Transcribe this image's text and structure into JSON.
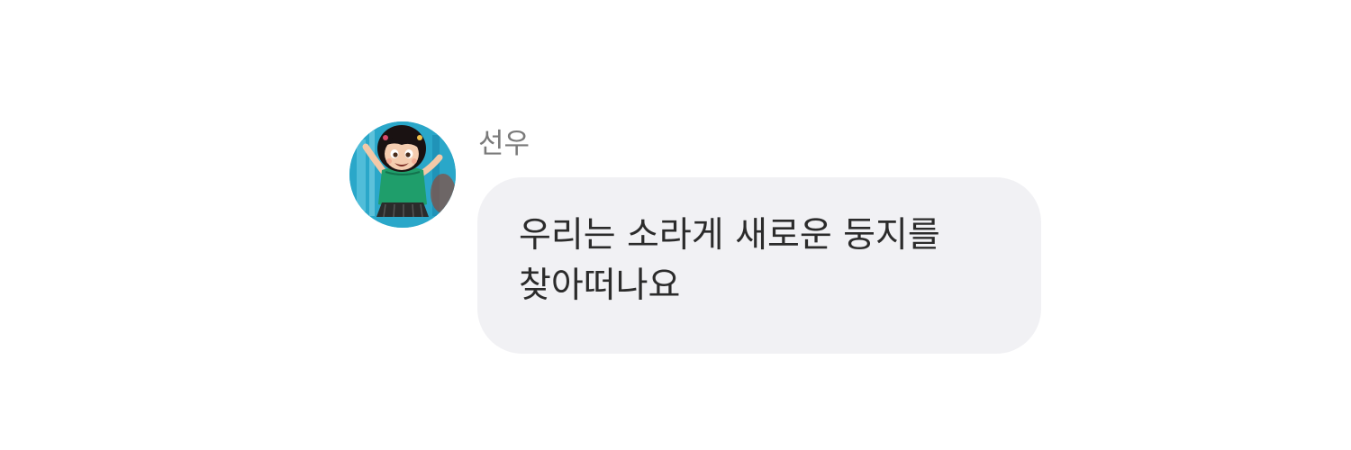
{
  "message": {
    "sender": {
      "name": "선우",
      "avatar_icon": "cartoon-girl-avatar-icon"
    },
    "text_lines": [
      "우리는 소라게 새로운 둥지를",
      "찾아떠나요"
    ]
  },
  "colors": {
    "background": "#ffffff",
    "bubble": "#f1f1f4",
    "name_text": "#7a7a7a",
    "message_text": "#2b2b2b",
    "avatar_bg": "#2aa7c9"
  }
}
